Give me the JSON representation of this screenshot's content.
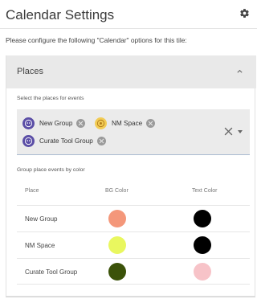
{
  "header": {
    "title": "Calendar Settings",
    "gear_icon": "gear-icon"
  },
  "intro_text": "Please configure the following \"Calendar\" options for this tile:",
  "places_section": {
    "title": "Places",
    "select_label": "Select the places for events",
    "selected": [
      {
        "label": "New Group",
        "avatar_color": "#5b4ea6"
      },
      {
        "label": "NM Space",
        "avatar_color": "#f2cc55"
      },
      {
        "label": "Curate Tool Group",
        "avatar_color": "#5b4ea6"
      }
    ],
    "color_label": "Group place events by color",
    "table": {
      "headers": {
        "place": "Place",
        "bg": "BG Color",
        "text": "Text Color"
      },
      "rows": [
        {
          "place": "New Group",
          "bg_color": "#f4977a",
          "text_color": "#000000"
        },
        {
          "place": "NM Space",
          "bg_color": "#e9f75f",
          "text_color": "#000000"
        },
        {
          "place": "Curate Tool Group",
          "bg_color": "#3b5209",
          "text_color": "#f7c3c8"
        }
      ]
    }
  }
}
